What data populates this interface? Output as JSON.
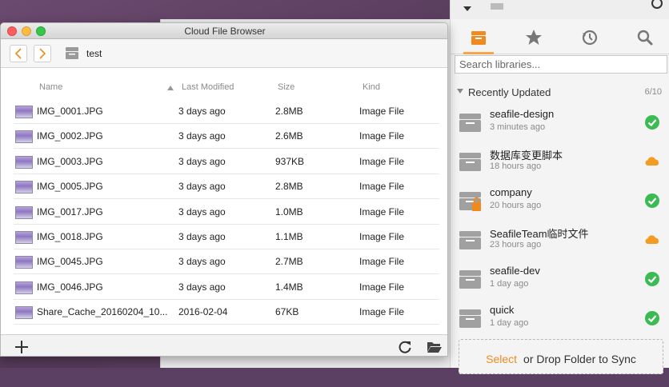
{
  "main_window": {
    "title": "Cloud File Browser",
    "breadcrumb": "test",
    "columns": [
      "Name",
      "Last Modified",
      "Size",
      "Kind"
    ],
    "files": [
      {
        "name": "IMG_0001.JPG",
        "modified": "3 days ago",
        "size": "2.8MB",
        "kind": "Image File"
      },
      {
        "name": "IMG_0002.JPG",
        "modified": "3 days ago",
        "size": "2.6MB",
        "kind": "Image File"
      },
      {
        "name": "IMG_0003.JPG",
        "modified": "3 days ago",
        "size": "937KB",
        "kind": "Image File"
      },
      {
        "name": "IMG_0005.JPG",
        "modified": "3 days ago",
        "size": "2.8MB",
        "kind": "Image File"
      },
      {
        "name": "IMG_0017.JPG",
        "modified": "3 days ago",
        "size": "1.0MB",
        "kind": "Image File"
      },
      {
        "name": "IMG_0018.JPG",
        "modified": "3 days ago",
        "size": "1.1MB",
        "kind": "Image File"
      },
      {
        "name": "IMG_0045.JPG",
        "modified": "3 days ago",
        "size": "2.7MB",
        "kind": "Image File"
      },
      {
        "name": "IMG_0046.JPG",
        "modified": "3 days ago",
        "size": "1.4MB",
        "kind": "Image File"
      },
      {
        "name": "Share_Cache_20160204_10...",
        "modified": "2016-02-04",
        "size": "67KB",
        "kind": "Image File"
      }
    ]
  },
  "seafile": {
    "search_placeholder": "Search libraries...",
    "section_title": "Recently Updated",
    "section_count": "6/10",
    "libraries": [
      {
        "name": "seafile-design",
        "time": "3 minutes ago",
        "status": "synced",
        "locked": false
      },
      {
        "name": "数据库变更脚本",
        "time": "18 hours ago",
        "status": "cloud",
        "locked": false
      },
      {
        "name": "company",
        "time": "20 hours ago",
        "status": "synced",
        "locked": true
      },
      {
        "name": "SeafileTeam临时文件",
        "time": "23 hours ago",
        "status": "cloud",
        "locked": false
      },
      {
        "name": "seafile-dev",
        "time": "1 day ago",
        "status": "synced",
        "locked": false
      },
      {
        "name": "quick",
        "time": "1 day ago",
        "status": "synced",
        "locked": false
      }
    ],
    "drop_select": "Select",
    "drop_text": "or Drop Folder to Sync"
  },
  "colors": {
    "accent": "#f7a44a",
    "synced": "#3cba54",
    "cloud": "#f39c22"
  }
}
